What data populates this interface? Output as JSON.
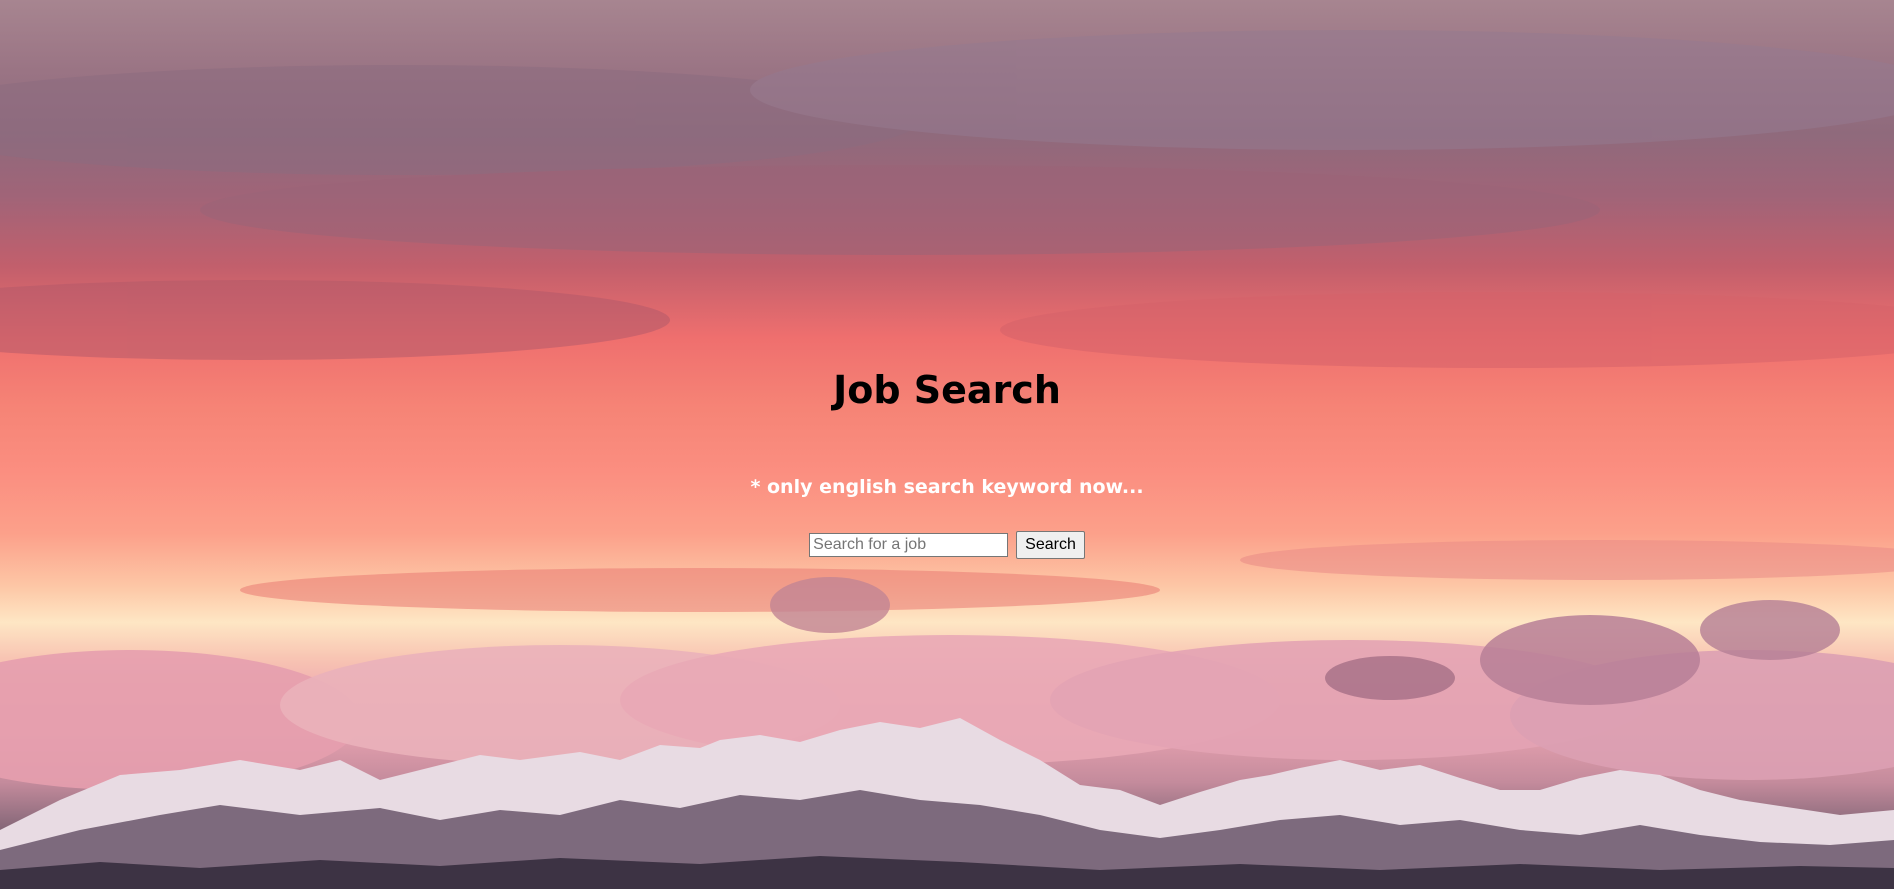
{
  "page": {
    "title": "Job Search",
    "notice": "* only english search keyword now...",
    "background": "sunset-sky-mountains-image"
  },
  "search": {
    "placeholder": "Search for a job",
    "value": "",
    "button_label": "Search"
  },
  "colors": {
    "title_text": "#000000",
    "notice_text": "#ffffff",
    "sky_top": "#a78590",
    "sky_mid": "#f68476",
    "horizon_glow": "#fee6c4",
    "mountains": "#473b4e"
  }
}
